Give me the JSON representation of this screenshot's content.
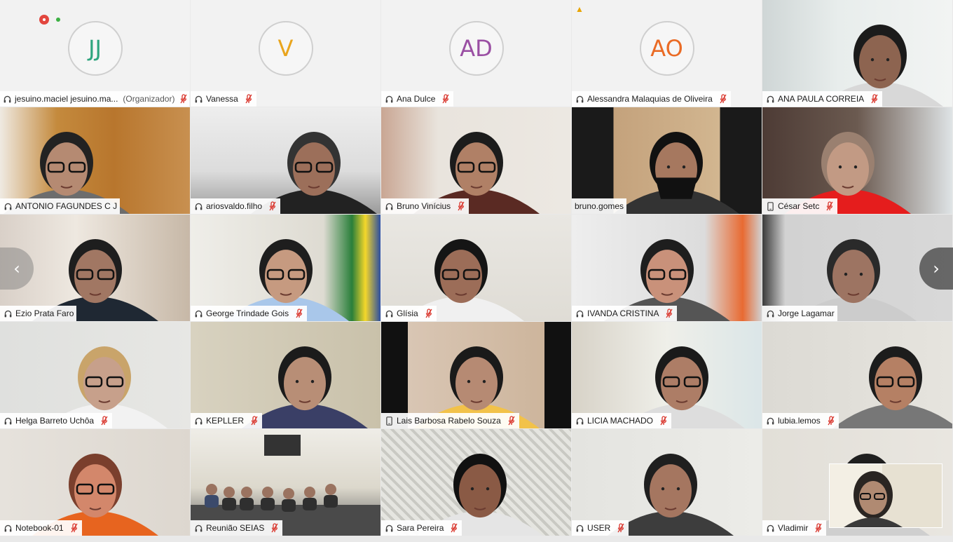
{
  "participants": [
    {
      "name": "jesuino.maciel jesuino.ma...",
      "role": "(Organizador)",
      "initials": "JJ",
      "initials_color": "#2fa57e",
      "mic": "headset",
      "muted": true
    },
    {
      "name": "Vanessa",
      "initials": "V",
      "initials_color": "#e9a51e",
      "mic": "headset",
      "muted": true
    },
    {
      "name": "Ana Dulce",
      "initials": "AD",
      "initials_color": "#9a4fa3",
      "mic": "headset",
      "muted": true
    },
    {
      "name": "Alessandra Malaquias de Oliveira",
      "initials": "AO",
      "initials_color": "#ea6b25",
      "mic": "headset",
      "muted": true
    },
    {
      "name": "ANA PAULA CORREIA",
      "mic": "headset",
      "muted": true
    },
    {
      "name": "ANTONIO FAGUNDES C J",
      "mic": "headset",
      "muted": false
    },
    {
      "name": "ariosvaldo.filho",
      "mic": "headset",
      "muted": true
    },
    {
      "name": "Bruno Vinícius",
      "mic": "headset",
      "muted": true
    },
    {
      "name": "bruno.gomes",
      "mic": "none",
      "muted": false
    },
    {
      "name": "César Setc",
      "mic": "phone",
      "muted": true
    },
    {
      "name": "Ezio Prata Faro",
      "mic": "headset",
      "muted": false
    },
    {
      "name": "George Trindade Gois",
      "mic": "headset",
      "muted": true
    },
    {
      "name": "Glísia",
      "mic": "headset",
      "muted": true
    },
    {
      "name": "IVANDA CRISTINA",
      "mic": "headset",
      "muted": true
    },
    {
      "name": "Jorge Lagamar",
      "mic": "headset",
      "muted": false
    },
    {
      "name": "Helga Barreto Uchôa",
      "mic": "headset",
      "muted": true
    },
    {
      "name": "KEPLLER",
      "mic": "headset",
      "muted": true
    },
    {
      "name": "Lais Barbosa Rabelo Souza",
      "mic": "phone",
      "muted": true
    },
    {
      "name": "LICIA MACHADO",
      "mic": "headset",
      "muted": true
    },
    {
      "name": "lubia.lemos",
      "mic": "headset",
      "muted": true
    },
    {
      "name": "Notebook-01",
      "mic": "headset",
      "muted": true
    },
    {
      "name": "Reunião SEIAS",
      "mic": "headset",
      "muted": true
    },
    {
      "name": "Sara Pereira",
      "mic": "headset",
      "muted": true
    },
    {
      "name": "USER",
      "mic": "headset",
      "muted": true
    },
    {
      "name": "Vladimir",
      "mic": "headset",
      "muted": true
    }
  ],
  "nav": {
    "prev_icon": "chevron-left-icon",
    "next_icon": "chevron-right-icon",
    "prev_glyph": "‹",
    "next_glyph": "›"
  },
  "indicators": {
    "recording_color": "#e2463e",
    "status_color": "#3cb043",
    "warning_glyph": "▲",
    "warning_color": "#e8a400",
    "selected_border": "#2cb7e8"
  }
}
